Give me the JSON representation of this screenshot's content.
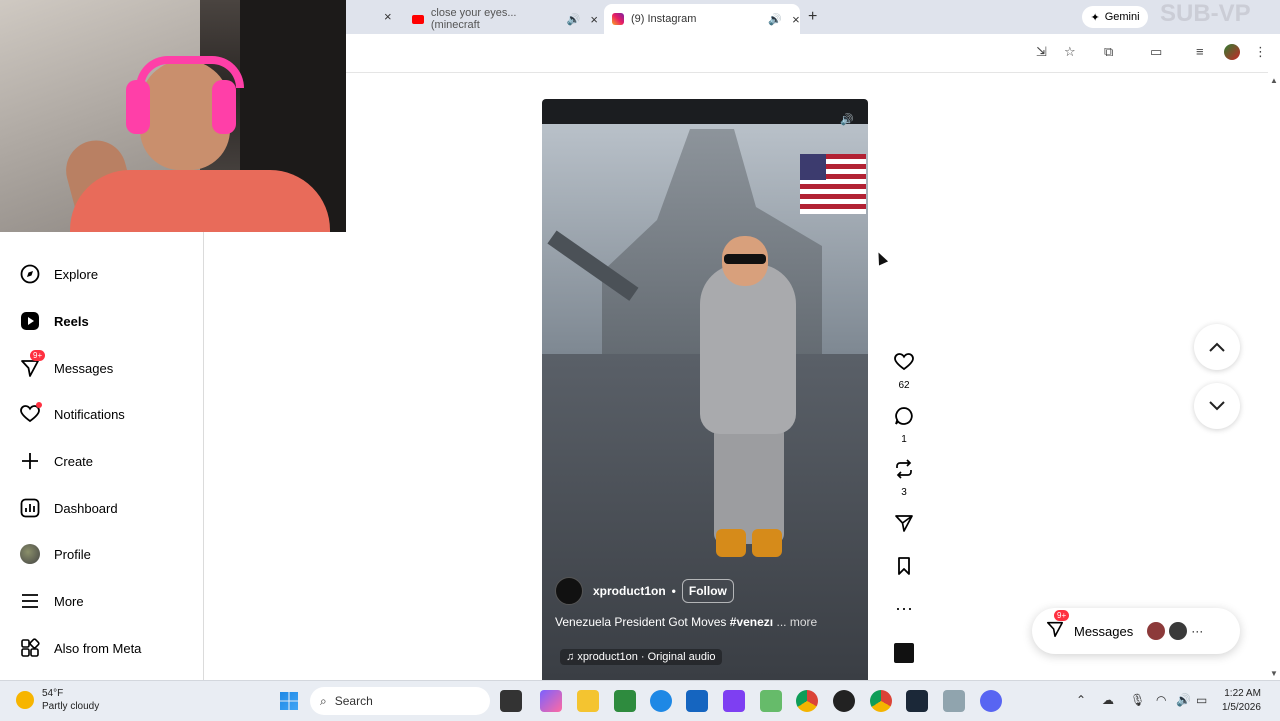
{
  "browser": {
    "tabs": [
      {
        "title": "close your eyes... (minecraft",
        "active": false,
        "favicon": "youtube-icon"
      },
      {
        "title": "(9) Instagram",
        "active": true,
        "favicon": "instagram-icon"
      }
    ],
    "gemini_label": "Gemini",
    "watermark": "SUB-VP",
    "close_symbol": "×",
    "new_tab_symbol": "+"
  },
  "sidebar": {
    "items": [
      {
        "label": "Explore",
        "icon": "compass-icon"
      },
      {
        "label": "Reels",
        "icon": "reels-icon",
        "active": true
      },
      {
        "label": "Messages",
        "icon": "messages-icon",
        "badge": "9+"
      },
      {
        "label": "Notifications",
        "icon": "heart-icon",
        "dot": true
      },
      {
        "label": "Create",
        "icon": "plus-icon"
      },
      {
        "label": "Dashboard",
        "icon": "dashboard-icon"
      },
      {
        "label": "Profile",
        "icon": "profile-avatar"
      },
      {
        "label": "More",
        "icon": "menu-icon"
      },
      {
        "label": "Also from Meta",
        "icon": "meta-apps-icon"
      }
    ]
  },
  "reel": {
    "username": "xproduct1on",
    "bullet": "•",
    "follow_label": "Follow",
    "caption": "Venezuela President Got Moves",
    "caption_tag": "#venezı",
    "caption_more": "... more",
    "audio": "xproduct1on · Original audio"
  },
  "actions": {
    "likes": "62",
    "comments": "1",
    "reposts": "3"
  },
  "messages_pill": {
    "label": "Messages",
    "badge": "9+"
  },
  "taskbar": {
    "weather_temp": "54°F",
    "weather_desc": "Partly cloudy",
    "search_placeholder": "Search",
    "time": "1:22 AM",
    "date": "1/5/2026"
  },
  "colors": {
    "badge_red": "#ff3040",
    "taskbar_bg": "#e9edf3",
    "tabbar_bg": "#dfe3ec"
  }
}
